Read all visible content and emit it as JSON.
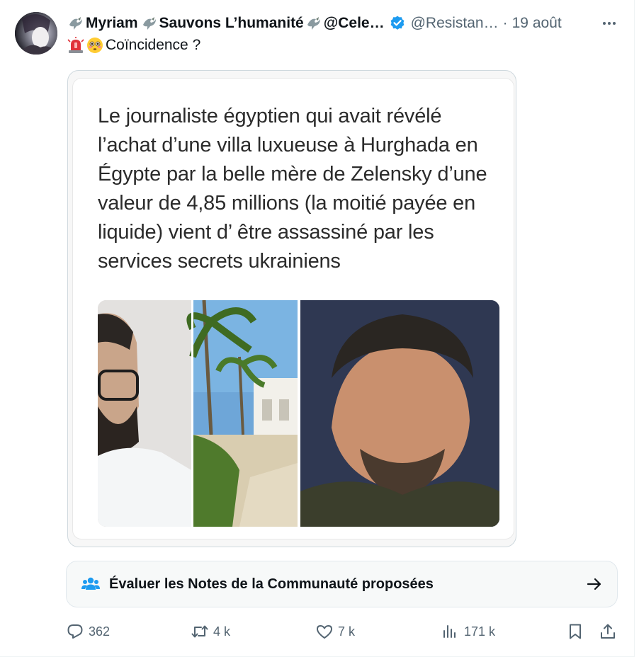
{
  "tweet": {
    "display_name_parts": [
      "Myriam",
      "Sauvons L’humanité",
      "@Cele…"
    ],
    "handle": "@Resistan…",
    "separator": "·",
    "date": "19 août",
    "text": "Coïncidence ?",
    "text_emojis": [
      "police-light-emoji",
      "flushed-face-emoji"
    ]
  },
  "media": {
    "caption": "Le journaliste égyptien qui avait révélé l’achat d’une villa luxueuse à Hurghada en Égypte par la belle mère de Zelensky d’une valeur de 4,85 millions (la moitié payée en liquide) vient d’ être assassiné par les services secrets ukrainiens"
  },
  "community_notes": {
    "label": "Évaluer les Notes de la Communauté proposées"
  },
  "actions": {
    "replies": "362",
    "reposts": "4 k",
    "likes": "7 k",
    "views": "171 k"
  },
  "colors": {
    "verified": "#1d9bf0",
    "secondary_text": "#536471",
    "primary_text": "#0f1419"
  }
}
